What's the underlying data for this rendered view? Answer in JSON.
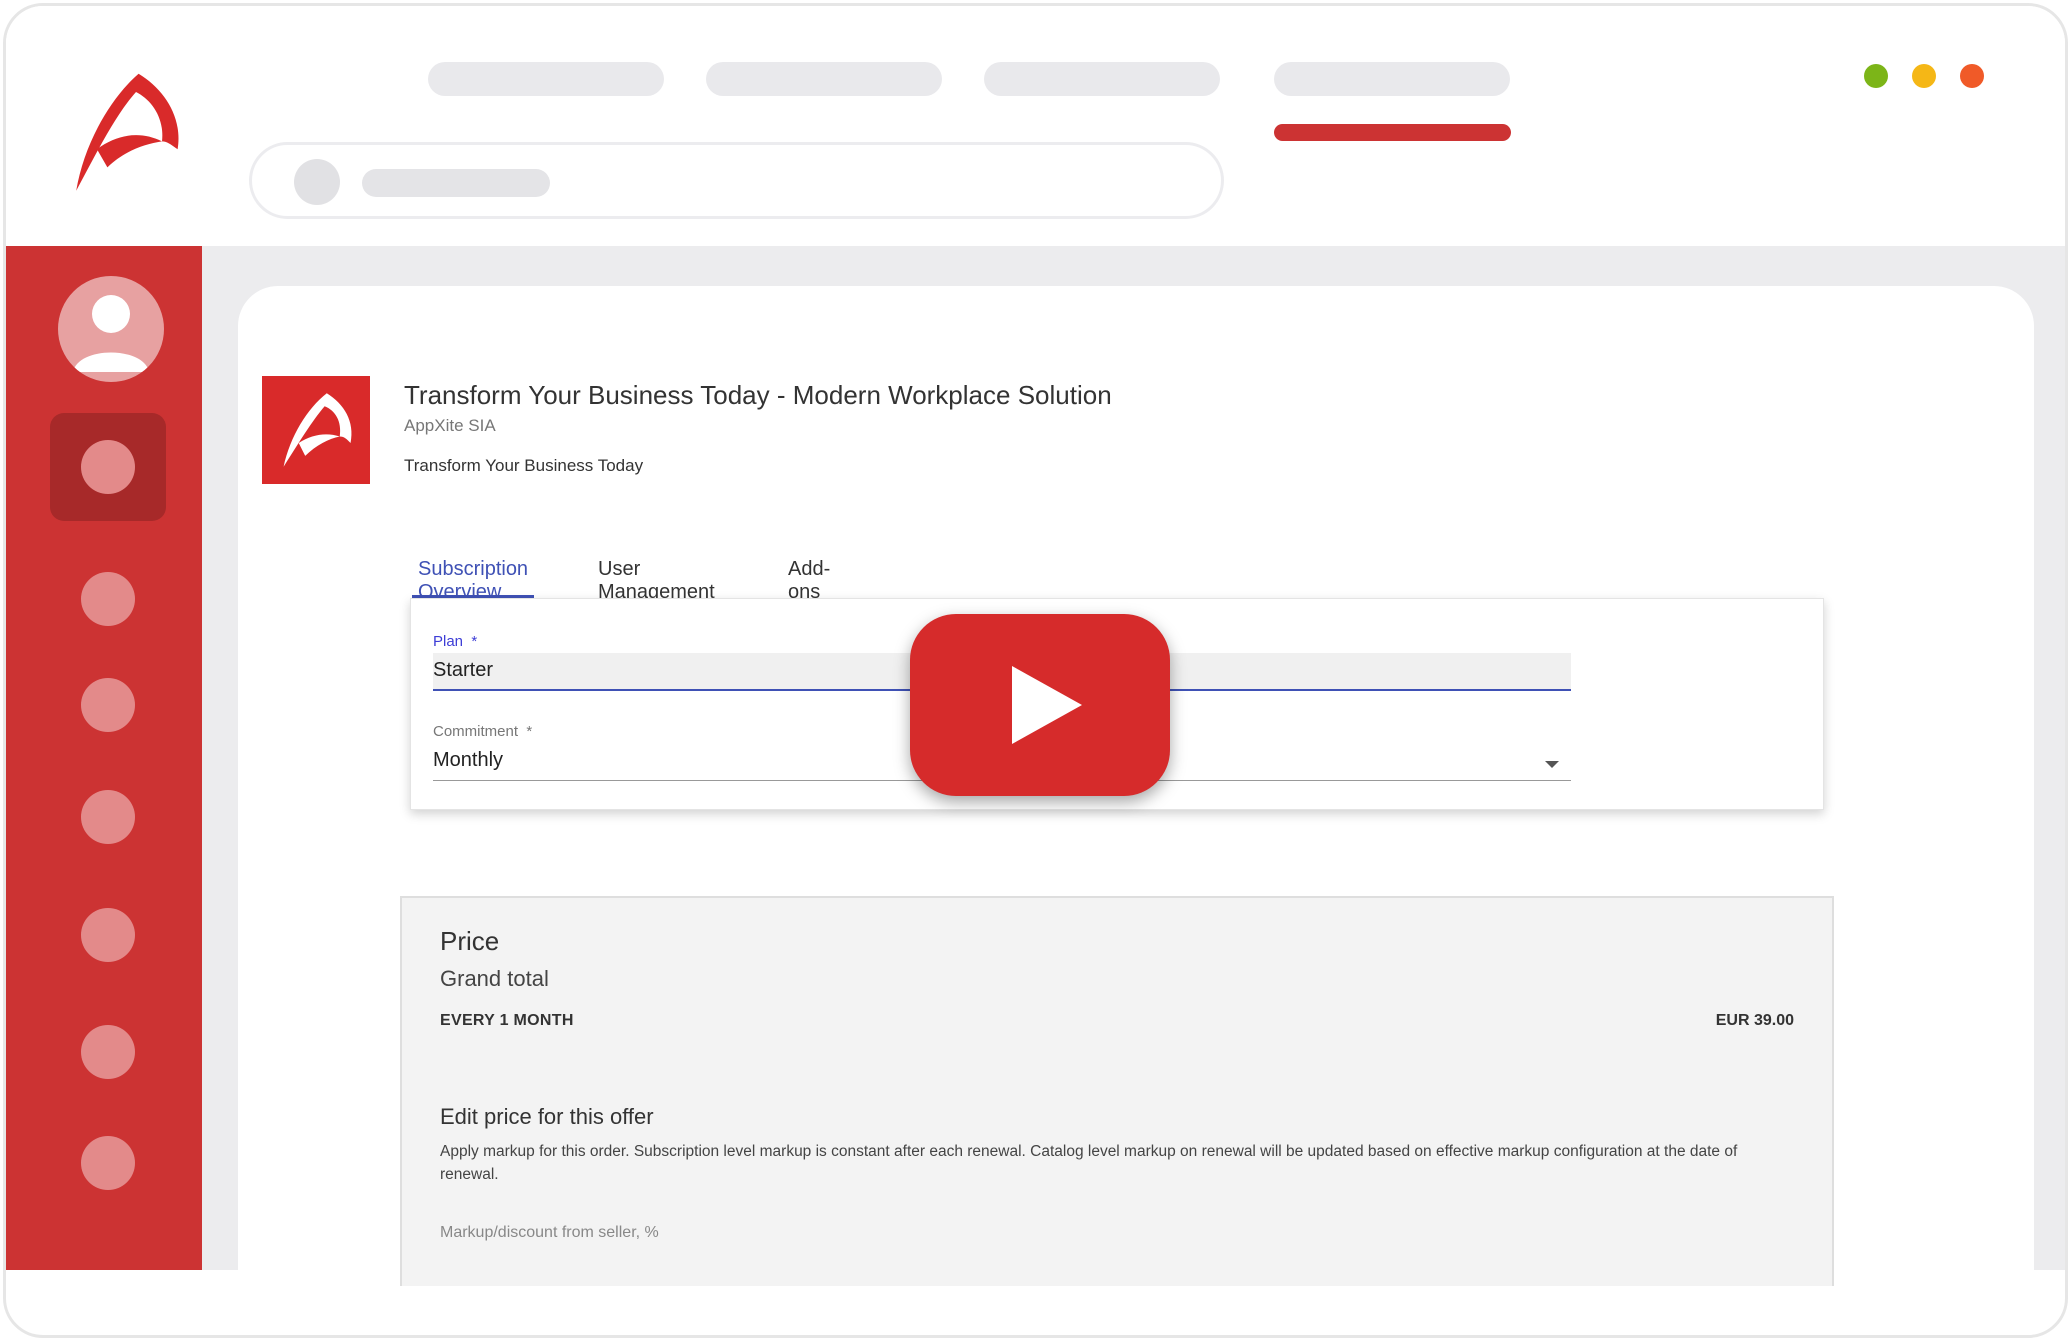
{
  "window_controls": [
    {
      "name": "green",
      "color": "#7cb518"
    },
    {
      "name": "yellow",
      "color": "#f5b716"
    },
    {
      "name": "orange",
      "color": "#f05a28"
    }
  ],
  "brand_color": "#cc3333",
  "product": {
    "title": "Transform Your Business Today - Modern Workplace Solution",
    "vendor": "AppXite SIA",
    "description": "Transform Your Business Today"
  },
  "tabs": [
    {
      "label": "Subscription Overview",
      "active": true
    },
    {
      "label": "User Management",
      "active": false
    },
    {
      "label": "Add-ons",
      "active": false
    }
  ],
  "form": {
    "plan": {
      "label": "Plan",
      "required_mark": "*",
      "value": "Starter"
    },
    "commitment": {
      "label": "Commitment",
      "required_mark": "*",
      "value": "Monthly"
    }
  },
  "price": {
    "heading": "Price",
    "grand_total_label": "Grand total",
    "period": "EVERY 1 MONTH",
    "amount": "EUR 39.00",
    "edit_heading": "Edit price for this offer",
    "edit_description": "Apply markup for this order. Subscription level markup is constant after each renewal. Catalog level markup on renewal will be updated based on effective markup configuration at the date of renewal.",
    "markup_label": "Markup/discount from seller, %"
  },
  "icons": {
    "logo": "appxite-logo",
    "play": "play-icon",
    "avatar": "user-avatar-icon",
    "dropdown": "chevron-down-icon"
  }
}
